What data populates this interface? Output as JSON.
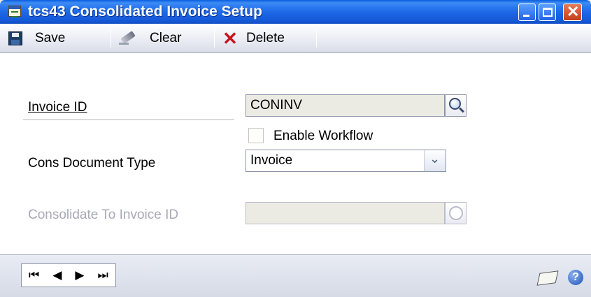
{
  "window": {
    "title": "tcs43 Consolidated Invoice Setup"
  },
  "toolbar": {
    "save_label": "Save",
    "clear_label": "Clear",
    "delete_label": "Delete"
  },
  "form": {
    "invoice_id_label": "Invoice ID",
    "invoice_id_value": "CONINV",
    "enable_workflow_label": "Enable Workflow",
    "enable_workflow_checked": false,
    "cons_document_type_label": "Cons Document Type",
    "cons_document_type_value": "Invoice",
    "consolidate_to_label": "Consolidate To Invoice ID",
    "consolidate_to_value": ""
  },
  "navigation": {
    "first": "⏮",
    "prev": "◀",
    "next": "▶",
    "last": "⏭"
  },
  "colors": {
    "titlebar": "#2a78f0",
    "delete_icon": "#c8141c",
    "disabled_text": "#a9a9b8"
  },
  "icons": [
    "save-icon",
    "eraser-icon",
    "delete-icon",
    "lookup-icon",
    "dropdown-arrow-icon",
    "note-icon",
    "help-icon"
  ]
}
